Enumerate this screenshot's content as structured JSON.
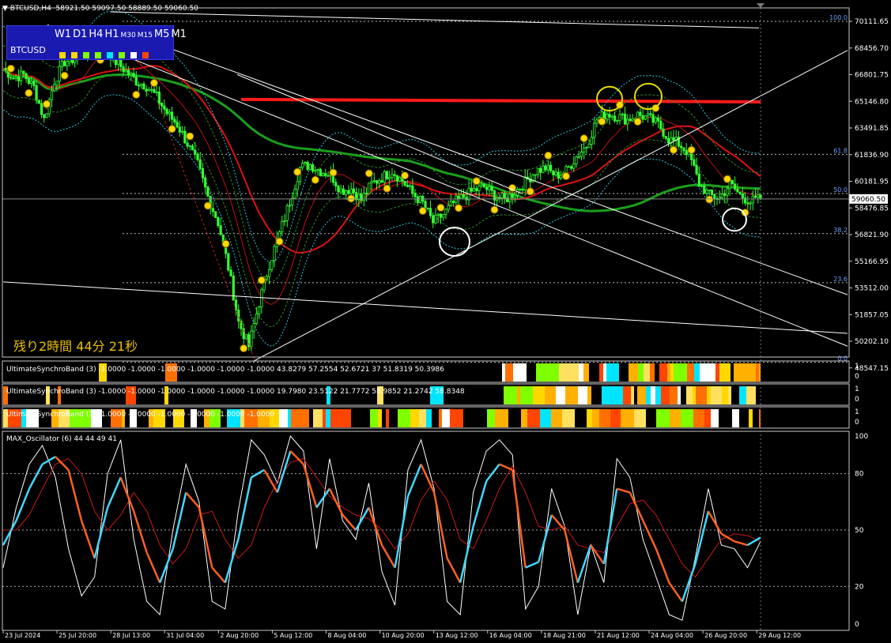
{
  "header": {
    "symbol_tf": "BTCUSD,H4",
    "ohlc": "58921.50 59097.50 58889.50 59060.50"
  },
  "panel": {
    "timeframes": [
      "W1",
      "D1",
      "H4",
      "H1",
      "M30",
      "M15",
      "M5",
      "M1"
    ],
    "symbol": "BTCUSD",
    "dot_colors": [
      "#ffd800",
      "#ffd800",
      "#7fff00",
      "#7fff00",
      "#00e5ff",
      "#7fff00",
      "#ffffff",
      "#ff4500"
    ]
  },
  "remaining_time": "残り2時間 44分 21秒",
  "chart_data": [
    {
      "type": "candlestick",
      "name": "price",
      "y_ticks": [
        "70111.65",
        "68456.70",
        "66801.75",
        "65146.80",
        "63491.85",
        "61836.90",
        "60181.95",
        "58476.85",
        "56821.90",
        "55166.95",
        "53512.00",
        "51857.05",
        "50202.10",
        "48547.15"
      ],
      "ylim": [
        48547.15,
        70111.65
      ],
      "last_price": "59060.50",
      "fib_levels": [
        {
          "label": "100.0",
          "value": 70111.65
        },
        {
          "label": "61.8",
          "value": 61836.9
        },
        {
          "label": "50.0",
          "value": 59395
        },
        {
          "label": "38.2",
          "value": 56900
        },
        {
          "label": "23.6",
          "value": 53850
        },
        {
          "label": "0.0",
          "value": 48900
        }
      ],
      "x_ticks": [
        "23 Jul 2024",
        "25 Jul 20:00",
        "28 Jul 13:00",
        "31 Jul 04:00",
        "2 Aug 20:00",
        "5 Aug 12:00",
        "8 Aug 04:00",
        "10 Aug 20:00",
        "13 Aug 12:00",
        "16 Aug 04:00",
        "18 Aug 21:00",
        "21 Aug 12:00",
        "24 Aug 04:00",
        "26 Aug 20:00",
        "29 Aug 12:00"
      ],
      "close_path": [
        [
          0,
          67200
        ],
        [
          4,
          66600
        ],
        [
          8,
          66800
        ],
        [
          12,
          66000
        ],
        [
          16,
          64000
        ],
        [
          20,
          66400
        ],
        [
          24,
          67600
        ],
        [
          28,
          67800
        ],
        [
          32,
          68100
        ],
        [
          36,
          68700
        ],
        [
          40,
          68400
        ],
        [
          44,
          67600
        ],
        [
          48,
          67000
        ],
        [
          52,
          66400
        ],
        [
          56,
          66100
        ],
        [
          60,
          65400
        ],
        [
          64,
          64400
        ],
        [
          68,
          63700
        ],
        [
          72,
          62500
        ],
        [
          76,
          61200
        ],
        [
          80,
          59200
        ],
        [
          84,
          57600
        ],
        [
          88,
          54800
        ],
        [
          92,
          51400
        ],
        [
          96,
          49900
        ],
        [
          100,
          52600
        ],
        [
          104,
          55000
        ],
        [
          108,
          56900
        ],
        [
          112,
          58900
        ],
        [
          116,
          61000
        ],
        [
          120,
          61200
        ],
        [
          124,
          60800
        ],
        [
          128,
          60600
        ],
        [
          132,
          59600
        ],
        [
          136,
          59700
        ],
        [
          140,
          59000
        ],
        [
          144,
          60000
        ],
        [
          148,
          60400
        ],
        [
          152,
          60800
        ],
        [
          156,
          60200
        ],
        [
          160,
          59400
        ],
        [
          164,
          58800
        ],
        [
          168,
          57600
        ],
        [
          172,
          58100
        ],
        [
          176,
          58800
        ],
        [
          180,
          59200
        ],
        [
          184,
          59600
        ],
        [
          188,
          59800
        ],
        [
          192,
          59300
        ],
        [
          196,
          59000
        ],
        [
          200,
          59500
        ],
        [
          204,
          60100
        ],
        [
          208,
          60800
        ],
        [
          212,
          61000
        ],
        [
          216,
          60500
        ],
        [
          220,
          60800
        ],
        [
          224,
          61700
        ],
        [
          228,
          62400
        ],
        [
          232,
          64000
        ],
        [
          236,
          64400
        ],
        [
          240,
          64200
        ],
        [
          244,
          64000
        ],
        [
          248,
          64300
        ],
        [
          252,
          64100
        ],
        [
          256,
          63700
        ],
        [
          260,
          62800
        ],
        [
          264,
          62500
        ],
        [
          268,
          61900
        ],
        [
          272,
          60000
        ],
        [
          276,
          59300
        ],
        [
          280,
          59100
        ],
        [
          284,
          60000
        ],
        [
          288,
          59300
        ],
        [
          292,
          58900
        ],
        [
          296,
          59060
        ]
      ]
    },
    {
      "type": "heatmap",
      "name": "UltimateSynchroBand (3) -1.0000 -1.0000 -1.0000 -1.0000 -1.0000 -1.0000 43.8279 57.2554 52.6721 37 51.8319 50.3986",
      "y_ticks": [
        "1",
        "0"
      ]
    },
    {
      "type": "heatmap",
      "name": "UltimateSynchroBand (3) -1.0000 -1.0000 -1.0000 -1.0000 -1.0000 -1.0000 19.7980 23.5122 21.7772 58.9852 21.2742 58.8348",
      "y_ticks": [
        "1",
        "0"
      ]
    },
    {
      "type": "heatmap",
      "name": "UltimateSynchroBand (3) -1.0000 -1.0000 -1.0000 -1.0000 -1.0000 -1.0000",
      "y_ticks": [
        "1",
        "0"
      ]
    },
    {
      "type": "line",
      "name": "MAX_Oscillator (6) 44 44 49 41",
      "y_ticks": [
        "100",
        "80",
        "50",
        "20",
        "0"
      ],
      "ylim": [
        0,
        100
      ],
      "series": [
        {
          "values": [
            42,
            55,
            72,
            85,
            89,
            82,
            55,
            35,
            62,
            78,
            60,
            38,
            22,
            40,
            70,
            62,
            30,
            22,
            45,
            78,
            82,
            70,
            92,
            85,
            62,
            72,
            58,
            50,
            62,
            42,
            30,
            68,
            85,
            70,
            35,
            22,
            52,
            76,
            85,
            82,
            30,
            33,
            58,
            50,
            22,
            42,
            32,
            72,
            70,
            55,
            40,
            22,
            12,
            32,
            60,
            48,
            44,
            42,
            46
          ]
        },
        {
          "values": [
            50,
            50,
            58,
            72,
            85,
            88,
            80,
            60,
            50,
            58,
            70,
            60,
            42,
            32,
            40,
            58,
            60,
            45,
            35,
            42,
            62,
            76,
            86,
            88,
            78,
            68,
            62,
            58,
            56,
            50,
            40,
            48,
            66,
            76,
            66,
            45,
            40,
            55,
            72,
            84,
            70,
            52,
            50,
            52,
            42,
            40,
            38,
            52,
            64,
            66,
            58,
            45,
            32,
            25,
            35,
            45,
            48,
            47,
            44
          ]
        },
        {
          "values": [
            30,
            62,
            85,
            95,
            78,
            40,
            15,
            25,
            80,
            98,
            45,
            12,
            5,
            50,
            85,
            65,
            12,
            8,
            60,
            98,
            90,
            75,
            100,
            92,
            40,
            88,
            55,
            45,
            75,
            28,
            10,
            82,
            98,
            72,
            12,
            5,
            70,
            92,
            98,
            90,
            8,
            20,
            72,
            52,
            5,
            42,
            22,
            88,
            78,
            45,
            25,
            5,
            2,
            35,
            72,
            42,
            40,
            30,
            44
          ]
        }
      ]
    }
  ]
}
